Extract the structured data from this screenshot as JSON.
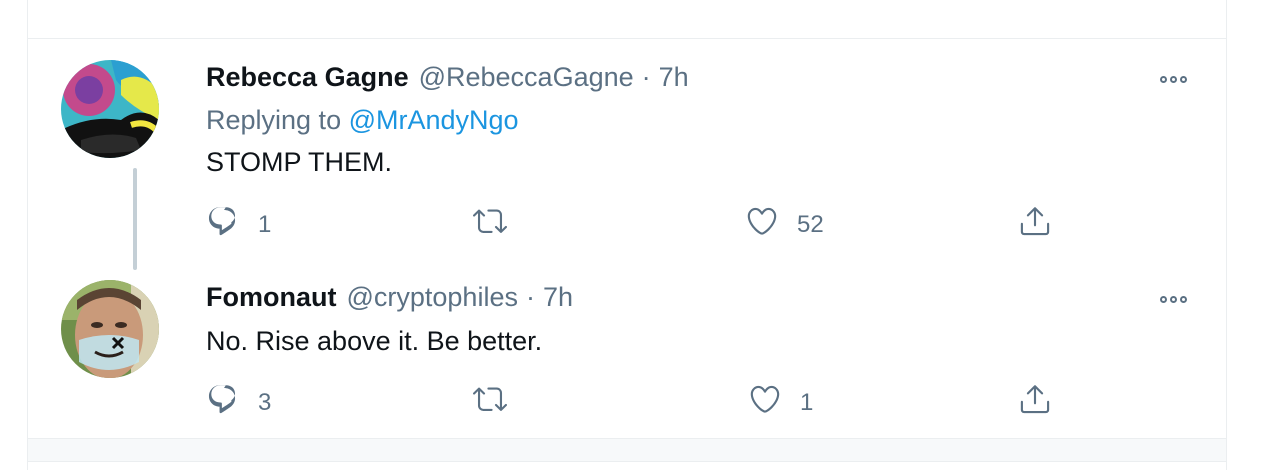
{
  "tweets": [
    {
      "name": "Rebecca Gagne",
      "handle": "@RebeccaGagne",
      "separator": "·",
      "time": "7h",
      "replying_prefix": "Replying to",
      "replying_handle": "@MrAndyNgo",
      "text": "STOMP THEM.",
      "replies": "1",
      "retweets": "",
      "likes": "52"
    },
    {
      "name": "Fomonaut",
      "handle": "@cryptophiles",
      "separator": "·",
      "time": "7h",
      "text": "No. Rise above it. Be better.",
      "replies": "3",
      "retweets": "",
      "likes": "1"
    }
  ],
  "icons": {
    "reply": "reply-icon",
    "retweet": "retweet-icon",
    "like": "heart-icon",
    "share": "share-icon",
    "more": "more-options-icon"
  },
  "colors": {
    "link": "#1b95e0",
    "secondary_text": "#5b7083",
    "border": "#ebeef0",
    "thread_line": "#c4cfd6"
  }
}
